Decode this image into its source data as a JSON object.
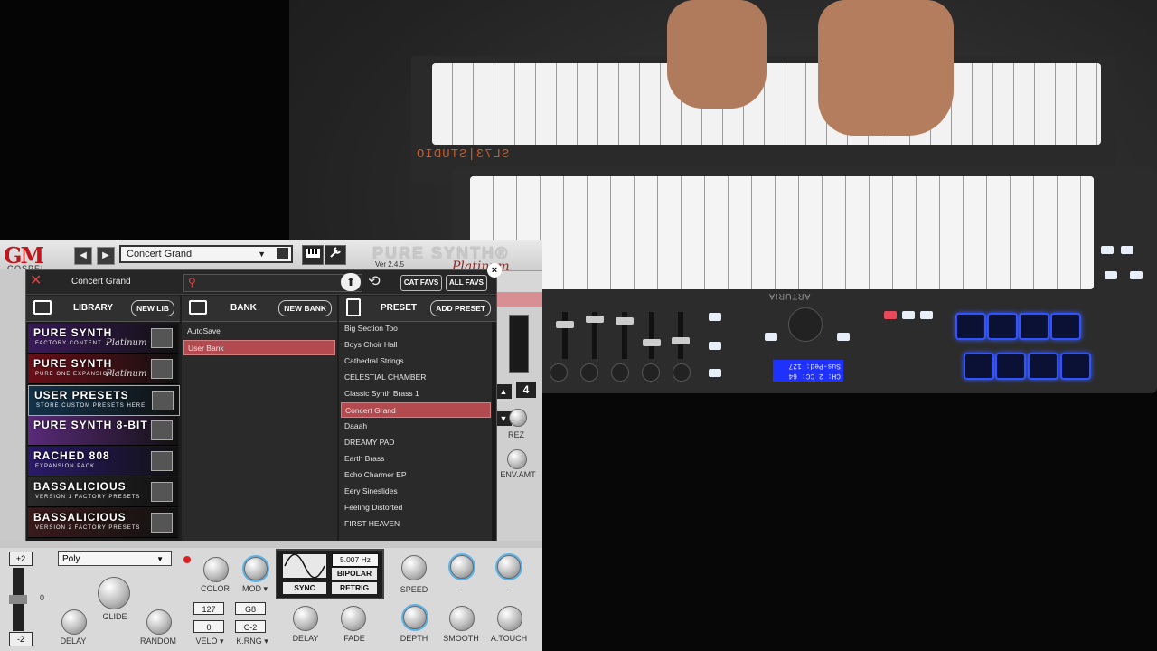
{
  "plugin": {
    "logo": "GM",
    "logo_sub": "GOSPEL",
    "preset_name": "Concert Grand",
    "dropdown_arrow": "▼",
    "title": "PURE SYNTH®",
    "version": "Ver 2.4.5",
    "platinum": "Platinum",
    "prev_icon": "◀",
    "next_icon": "▶",
    "keyboard_icon": "keyboard-icon",
    "wrench_icon": "wrench-icon"
  },
  "browser": {
    "title": "Concert Grand",
    "close_x": "✕",
    "cat_favs": "CAT FAVS",
    "all_favs": "ALL FAVS",
    "close_btn": "×",
    "library": {
      "label": "LIBRARY",
      "button": "NEW LIB"
    },
    "bank": {
      "label": "BANK",
      "button": "NEW BANK"
    },
    "preset": {
      "label": "PRESET",
      "button": "ADD PRESET"
    },
    "libraries": [
      {
        "title": "PURE SYNTH",
        "sub": "FACTORY CONTENT",
        "tag": "Platinum",
        "bg": "#3a1a5a"
      },
      {
        "title": "PURE SYNTH",
        "sub": "PURE ONE EXPANSION",
        "tag": "Platinum",
        "bg": "#6a0e18"
      },
      {
        "title": "USER PRESETS",
        "sub": "STORE CUSTOM PRESETS HERE",
        "tag": "",
        "bg": "#12324a"
      },
      {
        "title": "PURE SYNTH 8-BIT",
        "sub": "",
        "tag": "",
        "bg": "#5a2a7a"
      },
      {
        "title": "RACHED 808",
        "sub": "EXPANSION PACK",
        "tag": "",
        "bg": "#2a1a6a"
      },
      {
        "title": "BASSALICIOUS",
        "sub": "VERSION 1 FACTORY PRESETS",
        "tag": "",
        "bg": "#2a2a2a"
      },
      {
        "title": "BASSALICIOUS",
        "sub": "VERSION 2 FACTORY PRESETS",
        "tag": "",
        "bg": "#3a1a1a"
      }
    ],
    "banks": [
      "AutoSave",
      "User Bank"
    ],
    "selected_bank": "User Bank",
    "presets": [
      "Big Section Too",
      "Boys Choir Hall",
      "Cathedral Strings",
      "CELESTIAL CHAMBER",
      "Classic Synth Brass 1",
      "Concert Grand",
      "Daaah",
      "DREAMY PAD",
      "Earth Brass",
      "Echo Charmer EP",
      "Eery Sineslides",
      "Feeling Distorted",
      "FIRST HEAVEN"
    ],
    "selected_preset": "Concert Grand"
  },
  "side": {
    "value": "4",
    "up": "▲",
    "down": "▼",
    "rez_label": "REZ",
    "envamt_label": "ENV.AMT"
  },
  "bottom": {
    "plus2": "+2",
    "minus2": "-2",
    "zero": "0",
    "mode": "Poly",
    "glide_label": "GLIDE",
    "delay_label": "DELAY",
    "random_label": "RANDOM",
    "color_label": "COLOR",
    "mod_label": "MOD ▾",
    "velo_top": "127",
    "velo_bottom": "0",
    "krng_top": "G8",
    "krng_bottom": "C-2",
    "velo_label": "VELO ▾",
    "krng_label": "K.RNG ▾",
    "lfo_rate": "5.007 Hz",
    "bipolar": "BIPOLAR",
    "sync": "SYNC",
    "retrig": "RETRIG",
    "speed_label": "SPEED",
    "delay2_label": "DELAY",
    "fade_label": "FADE",
    "depth_label": "DEPTH",
    "smooth_label": "SMOOTH",
    "atouch_label": "A.TOUCH",
    "dash1": "-",
    "dash2": "-"
  },
  "hardware": {
    "sl_label": "SL73|STUDIO",
    "arturia": "ARTURIA",
    "lcd_line1": "CH: 2  CC: 64",
    "lcd_line2": "Sus-Ped: 127"
  },
  "colors": {
    "selection": "#b24a4f",
    "accent_red": "#c0161c",
    "pad_blue": "#2f54ff"
  }
}
